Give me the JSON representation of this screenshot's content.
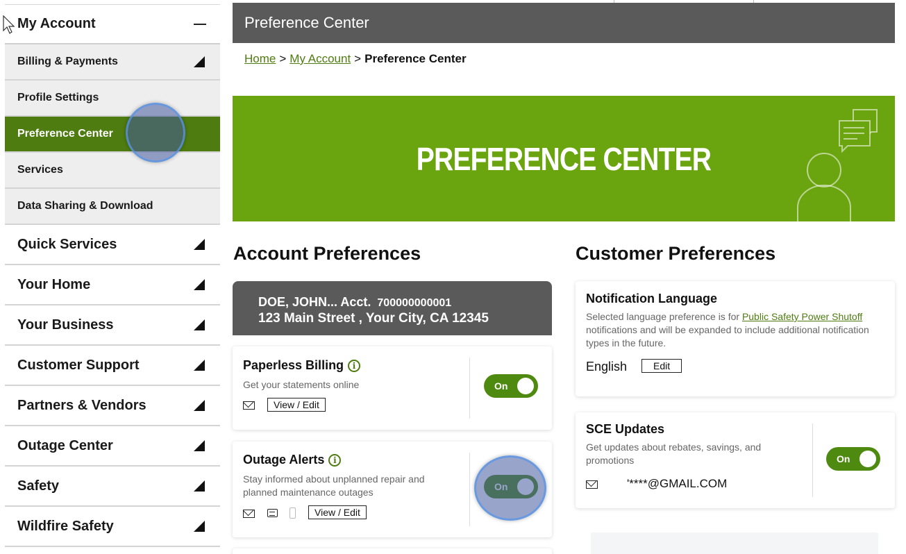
{
  "sidebar": {
    "header": "My Account",
    "sub_items": [
      {
        "label": "Billing & Payments",
        "has_arrow": true
      },
      {
        "label": "Profile Settings",
        "has_arrow": false
      },
      {
        "label": "Preference Center",
        "has_arrow": false,
        "active": true
      },
      {
        "label": "Services",
        "has_arrow": false
      },
      {
        "label": "Data Sharing & Download",
        "has_arrow": false
      }
    ],
    "main_items": [
      {
        "label": "Quick Services"
      },
      {
        "label": "Your Home"
      },
      {
        "label": "Your Business"
      },
      {
        "label": "Customer Support"
      },
      {
        "label": "Partners & Vendors"
      },
      {
        "label": "Outage Center"
      },
      {
        "label": "Safety"
      },
      {
        "label": "Wildfire Safety"
      }
    ]
  },
  "topbar": {
    "title": "Preference Center"
  },
  "breadcrumb": {
    "home": "Home",
    "account": "My Account",
    "sep": ">",
    "current": "Preference Center"
  },
  "banner": {
    "title": "PREFERENCE CENTER"
  },
  "account_prefs": {
    "heading": "Account Preferences",
    "account_name": "DOE, JOHN... Acct.",
    "account_number": "700000000001",
    "address": "123 Main Street , Your City, CA 12345",
    "paperless": {
      "title": "Paperless Billing",
      "desc": "Get your statements online",
      "button": "View / Edit",
      "toggle": "On"
    },
    "outage": {
      "title": "Outage Alerts",
      "desc_line1": "Stay informed about unplanned repair and",
      "desc_line2": "planned maintenance outages",
      "button": "View / Edit",
      "toggle": "On"
    }
  },
  "customer_prefs": {
    "heading": "Customer Preferences",
    "language": {
      "title": "Notification Language",
      "desc_before": "Selected language preference is for",
      "desc_link": "Public Safety Power Shutoff",
      "desc_after": "notifications and will be expanded to include additional notification types in the future.",
      "value": "English",
      "button": "Edit"
    },
    "sce_updates": {
      "title": "SCE Updates",
      "desc": "Get updates about rebates, savings, and promotions",
      "email": "'****@GMAIL.COM",
      "toggle": "On"
    }
  },
  "info_glyph": "i",
  "colors": {
    "brand_green": "#6aa50f",
    "dark_green": "#4e7c10",
    "header_gray": "#5a5a5a"
  }
}
